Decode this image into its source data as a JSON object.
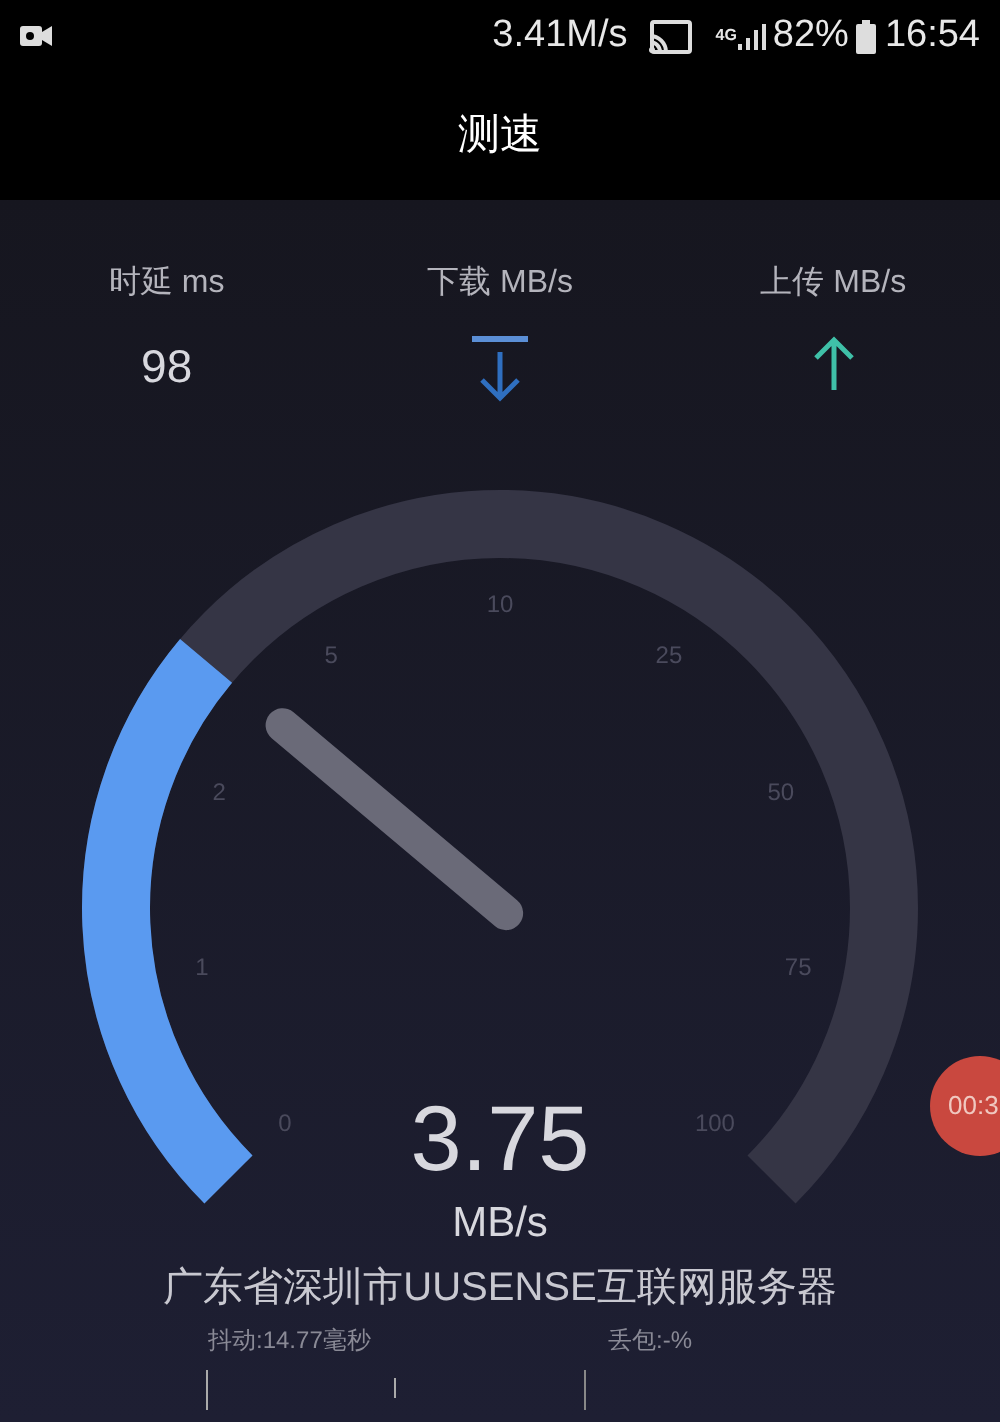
{
  "status_bar": {
    "net_speed": "3.41M/s",
    "network": "4G",
    "battery": "82%",
    "time": "16:54"
  },
  "title": "测速",
  "metrics": [
    {
      "kind": "value",
      "label": "时延 ms",
      "value": "98"
    },
    {
      "kind": "download",
      "label": "下载 MB/s"
    },
    {
      "kind": "upload",
      "label": "上传 MB/s"
    }
  ],
  "gauge": {
    "ticks": [
      "0",
      "1",
      "2",
      "5",
      "10",
      "25",
      "50",
      "75",
      "100"
    ],
    "reading": "3.75",
    "unit": "MB/s"
  },
  "timer_badge": "00:3",
  "server": "广东省深圳市UUSENSE互联网服务器",
  "jitter": "抖动:14.77毫秒",
  "packet_loss": "丢包:-%"
}
